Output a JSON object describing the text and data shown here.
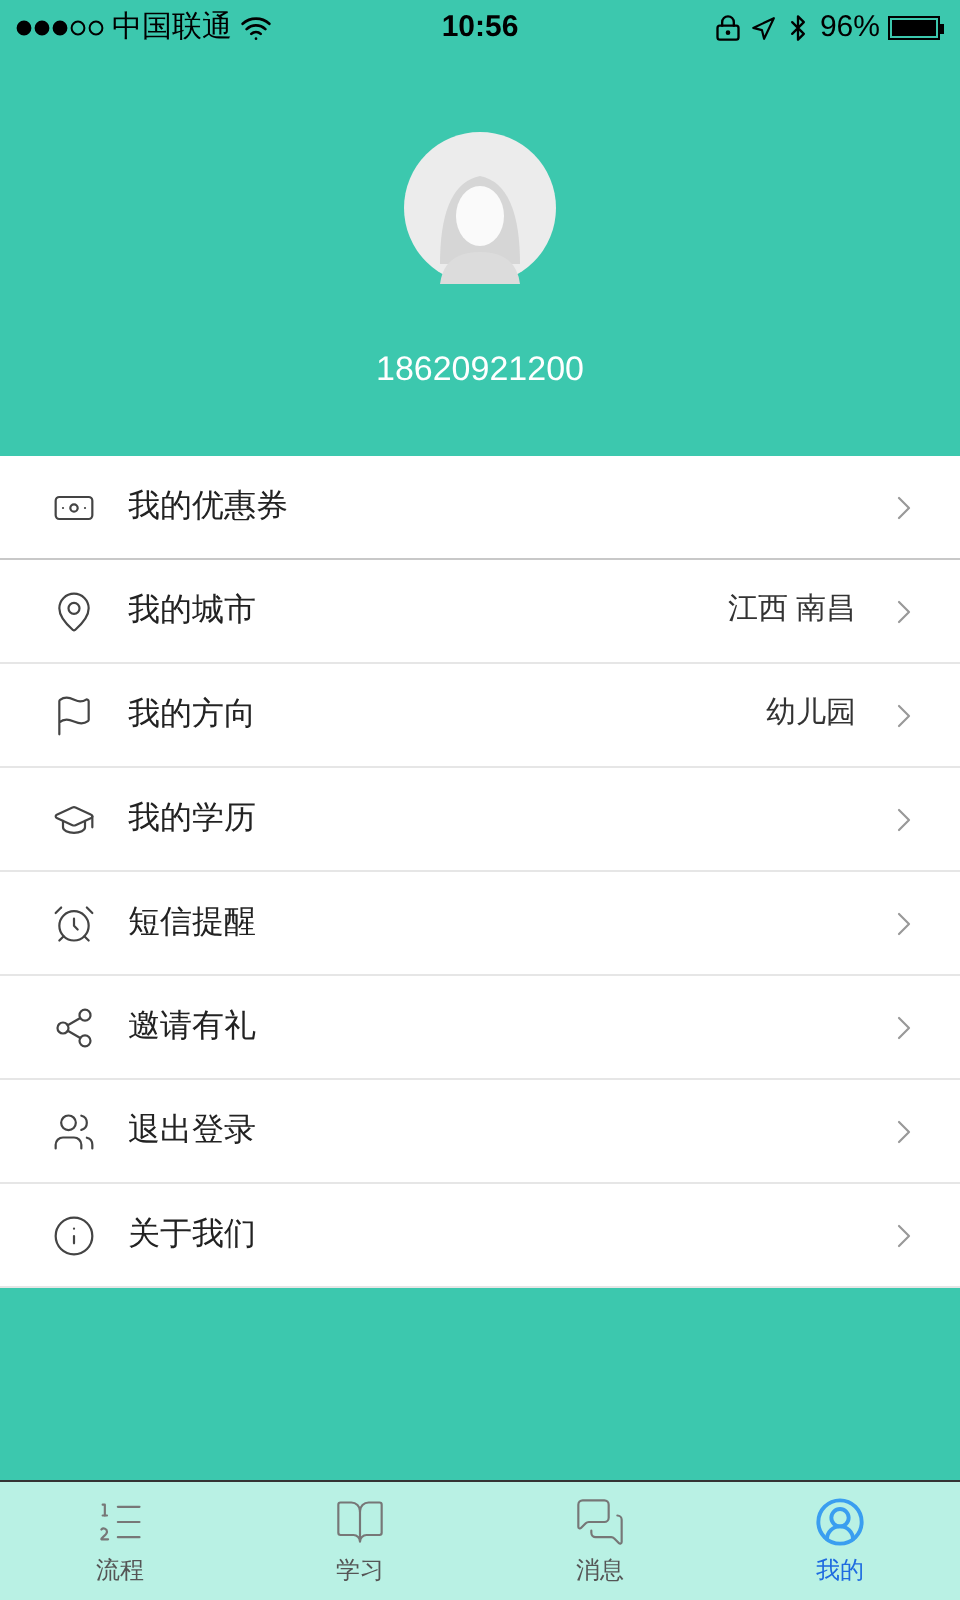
{
  "status_bar": {
    "carrier": "中国联通",
    "time": "10:56",
    "battery": "96%"
  },
  "profile": {
    "phone": "18620921200"
  },
  "menu": [
    {
      "label": "我的优惠券"
    },
    {
      "label": "我的城市",
      "value": "江西 南昌"
    },
    {
      "label": "我的方向",
      "value": "幼儿园"
    },
    {
      "label": "我的学历"
    },
    {
      "label": "短信提醒"
    },
    {
      "label": "邀请有礼"
    },
    {
      "label": "退出登录"
    },
    {
      "label": "关于我们"
    }
  ],
  "tabs": [
    {
      "label": "流程",
      "selected": false
    },
    {
      "label": "学习",
      "selected": false
    },
    {
      "label": "消息",
      "selected": false
    },
    {
      "label": "我的",
      "selected": true
    }
  ]
}
